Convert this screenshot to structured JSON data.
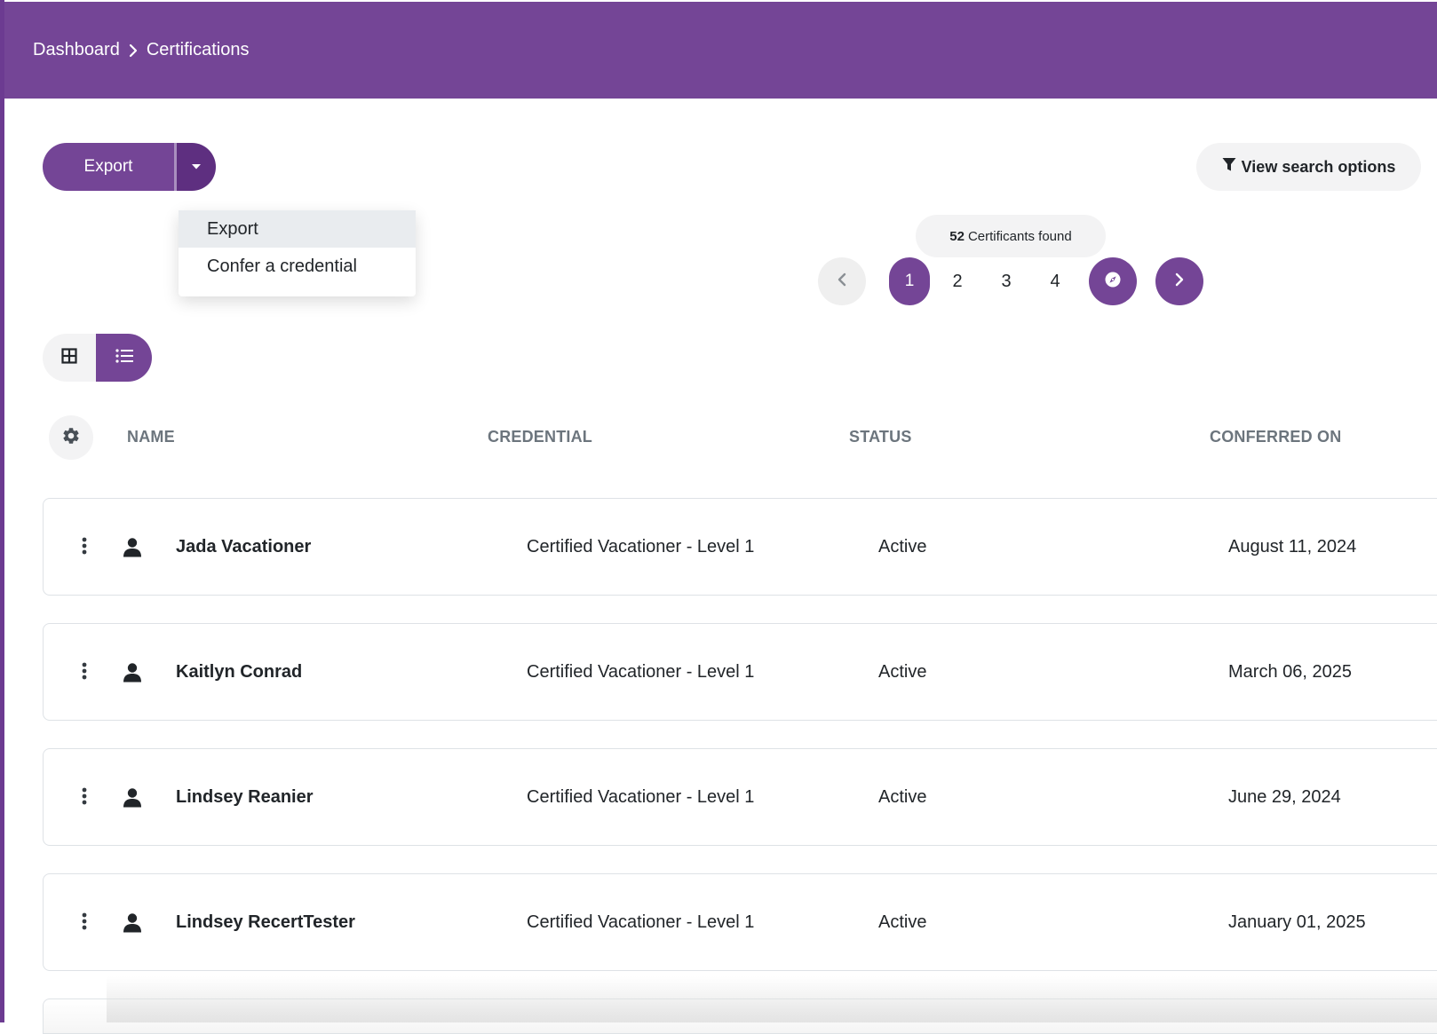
{
  "breadcrumb": {
    "home": "Dashboard",
    "current": "Certifications"
  },
  "toolbar": {
    "export_label": "Export",
    "search_options_label": "View search options"
  },
  "export_menu": {
    "items": [
      {
        "label": "Export",
        "highlighted": true
      },
      {
        "label": "Confer a credential",
        "highlighted": false
      }
    ]
  },
  "results": {
    "count": "52",
    "suffix": "Certificants found"
  },
  "pagination": {
    "current": "1",
    "pages": [
      "2",
      "3",
      "4"
    ]
  },
  "view_mode": "list",
  "table": {
    "headers": {
      "name": "NAME",
      "credential": "CREDENTIAL",
      "status": "STATUS",
      "conferred_on": "CONFERRED ON"
    },
    "rows": [
      {
        "name": "Jada Vacationer",
        "credential": "Certified Vacationer - Level 1",
        "status": "Active",
        "conferred_on": "August 11, 2024"
      },
      {
        "name": "Kaitlyn Conrad",
        "credential": "Certified Vacationer - Level 1",
        "status": "Active",
        "conferred_on": "March 06, 2025"
      },
      {
        "name": "Lindsey Reanier",
        "credential": "Certified Vacationer - Level 1",
        "status": "Active",
        "conferred_on": "June 29, 2024"
      },
      {
        "name": "Lindsey RecertTester",
        "credential": "Certified Vacationer - Level 1",
        "status": "Active",
        "conferred_on": "January 01, 2025"
      }
    ]
  },
  "colors": {
    "brand": "#744596",
    "brand_dark": "#5e2f80",
    "muted_bg": "#f3f3f4",
    "header_text": "#6c757d"
  },
  "icons": [
    "chevron-right-icon",
    "caret-down-icon",
    "filter-icon",
    "chevron-left-icon",
    "compass-icon",
    "grid-icon",
    "list-icon",
    "gear-icon",
    "kebab-icon",
    "person-icon"
  ]
}
